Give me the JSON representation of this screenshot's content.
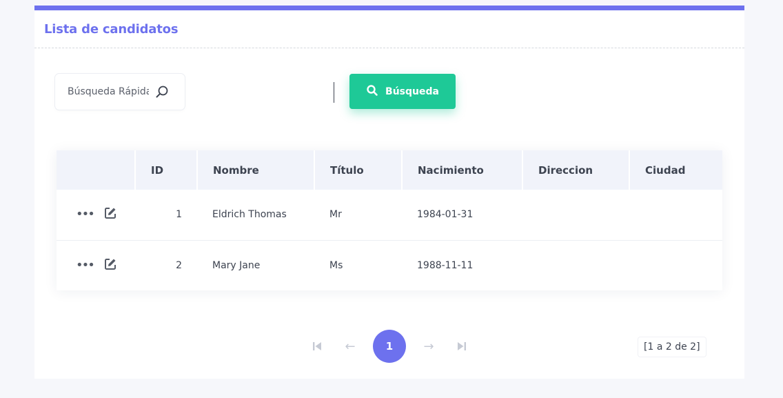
{
  "header": {
    "title": "Lista de candidatos"
  },
  "toolbar": {
    "search_placeholder": "Búsqueda Rápida",
    "search_button_label": "Búsqueda"
  },
  "table": {
    "columns": [
      "",
      "ID",
      "Nombre",
      "Título",
      "Nacimiento",
      "Direccion",
      "Ciudad"
    ],
    "rows": [
      {
        "id": "1",
        "nombre": "Eldrich Thomas",
        "titulo": "Mr",
        "nacimiento": "1984-01-31",
        "direccion": "",
        "ciudad": ""
      },
      {
        "id": "2",
        "nombre": "Mary Jane",
        "titulo": "Ms",
        "nacimiento": "1988-11-11",
        "direccion": "",
        "ciudad": ""
      }
    ],
    "more_glyph": "•••"
  },
  "pagination": {
    "current_page": "1",
    "summary": "[1 a 2 de 2]",
    "first_glyph": "⏮",
    "prev_glyph": "←",
    "next_glyph": "→",
    "last_glyph": "⏭"
  },
  "colors": {
    "accent": "#6d71ee",
    "success": "#1ec997",
    "header_bg": "#f1f3fa"
  },
  "icons": {
    "search": "search-icon",
    "edit": "edit-icon",
    "more": "more-icon"
  }
}
